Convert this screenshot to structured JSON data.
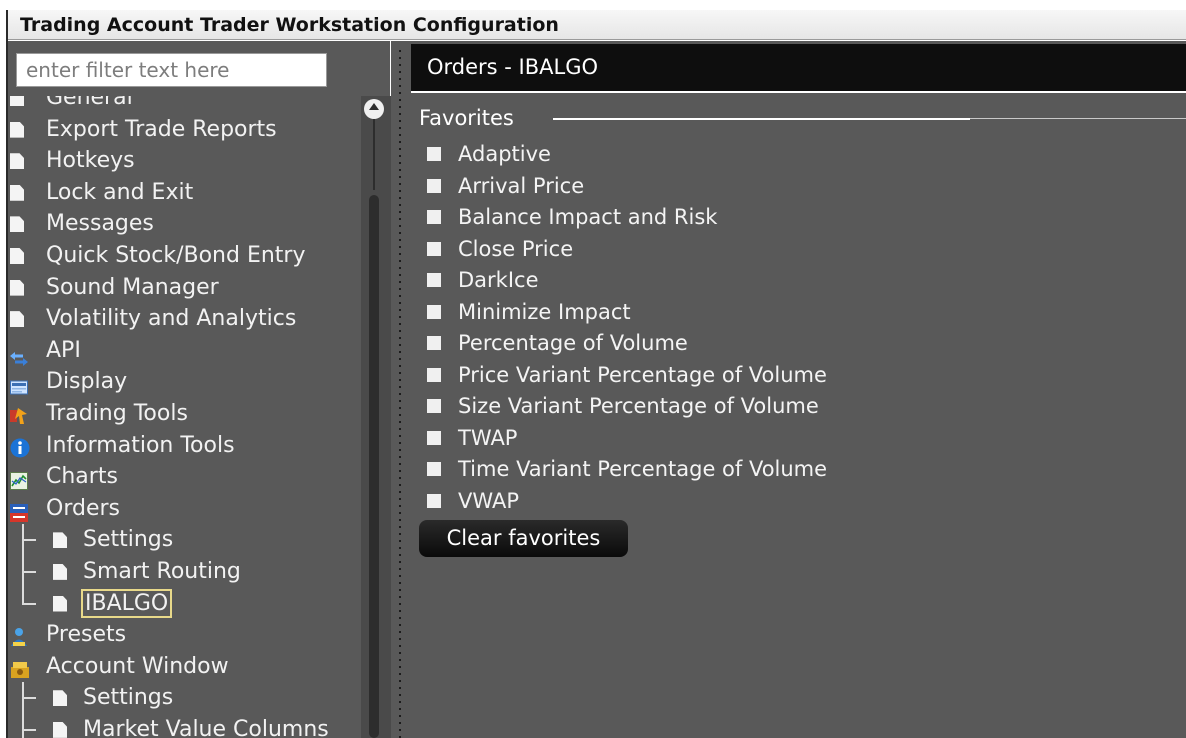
{
  "window": {
    "title": "Trading Account Trader Workstation Configuration"
  },
  "sidebar": {
    "filter_placeholder": "enter filter text here",
    "items": [
      {
        "label": "General",
        "icon": "document-icon"
      },
      {
        "label": "Export Trade Reports",
        "icon": "document-icon"
      },
      {
        "label": "Hotkeys",
        "icon": "document-icon"
      },
      {
        "label": "Lock and Exit",
        "icon": "document-icon"
      },
      {
        "label": "Messages",
        "icon": "document-icon"
      },
      {
        "label": "Quick Stock/Bond Entry",
        "icon": "document-icon"
      },
      {
        "label": "Sound Manager",
        "icon": "document-icon"
      },
      {
        "label": "Volatility and Analytics",
        "icon": "document-icon"
      },
      {
        "label": "API",
        "icon": "arrows-icon"
      },
      {
        "label": "Display",
        "icon": "display-icon"
      },
      {
        "label": "Trading Tools",
        "icon": "trading-tools-icon"
      },
      {
        "label": "Information Tools",
        "icon": "info-icon"
      },
      {
        "label": "Charts",
        "icon": "chart-icon"
      },
      {
        "label": "Orders",
        "icon": "orders-icon"
      },
      {
        "label": "Settings",
        "icon": "document-icon"
      },
      {
        "label": "Smart Routing",
        "icon": "document-icon"
      },
      {
        "label": "IBALGO",
        "icon": "document-icon",
        "selected": true
      },
      {
        "label": "Presets",
        "icon": "presets-icon"
      },
      {
        "label": "Account Window",
        "icon": "account-window-icon"
      },
      {
        "label": "Settings",
        "icon": "document-icon"
      },
      {
        "label": "Market Value Columns",
        "icon": "document-icon"
      }
    ]
  },
  "main": {
    "header": "Orders - IBALGO",
    "favorites_title": "Favorites",
    "favorites": [
      "Adaptive",
      "Arrival Price",
      "Balance Impact and Risk",
      "Close Price",
      "DarkIce",
      "Minimize Impact",
      "Percentage of Volume",
      "Price Variant Percentage of Volume",
      "Size Variant Percentage of Volume",
      "TWAP",
      "Time Variant Percentage of Volume",
      "VWAP"
    ],
    "clear_button": "Clear favorites"
  },
  "colors": {
    "panel_bg": "#595959",
    "header_bg": "#0e0e0e",
    "selection_outline": "#e8d98a"
  }
}
